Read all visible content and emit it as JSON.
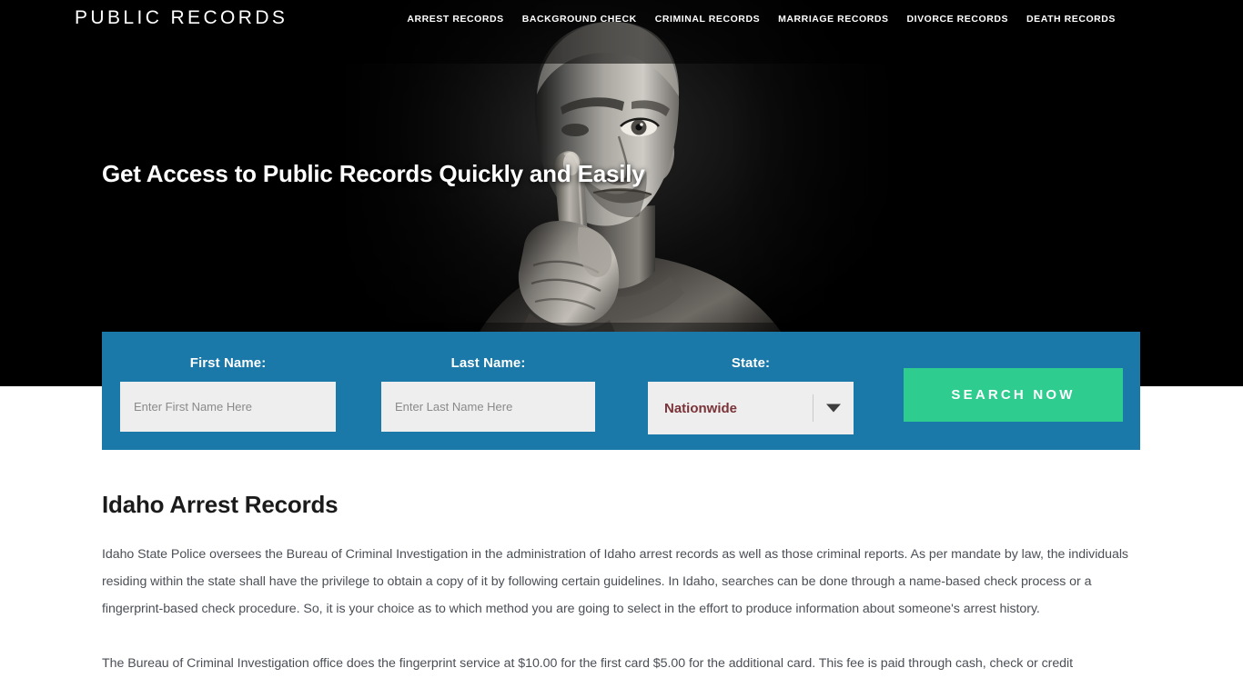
{
  "header": {
    "brand": "PUBLIC RECORDS",
    "nav": [
      {
        "label": "ARREST RECORDS"
      },
      {
        "label": "BACKGROUND CHECK"
      },
      {
        "label": "CRIMINAL RECORDS"
      },
      {
        "label": "MARRIAGE RECORDS"
      },
      {
        "label": "DIVORCE RECORDS"
      },
      {
        "label": "DEATH RECORDS"
      }
    ]
  },
  "hero": {
    "title": "Get Access to Public Records Quickly and Easily",
    "image_description": "black-and-white photo of a man holding index finger to his lips in a shush gesture"
  },
  "search_form": {
    "background_color": "#1a79a8",
    "first_name": {
      "label": "First Name:",
      "placeholder": "Enter First Name Here",
      "value": ""
    },
    "last_name": {
      "label": "Last Name:",
      "placeholder": "Enter Last Name Here",
      "value": ""
    },
    "state": {
      "label": "State:",
      "selected": "Nationwide"
    },
    "submit": {
      "label": "SEARCH NOW",
      "color": "#2ecc8f"
    }
  },
  "main": {
    "title": "Idaho Arrest Records",
    "paragraphs": [
      "Idaho State Police oversees the Bureau of Criminal Investigation in the administration of Idaho arrest records as well as those criminal reports. As per mandate by law, the individuals residing within the state shall have the privilege to obtain a copy of it by following certain guidelines. In Idaho, searches can be done through a name-based check process or a fingerprint-based check procedure. So, it is your choice as to which method you are going to select in the effort to produce information about someone's arrest history.",
      "The Bureau of Criminal Investigation office does the fingerprint service at $10.00 for the first card $5.00 for the additional card. This fee is paid through cash, check or credit"
    ]
  }
}
